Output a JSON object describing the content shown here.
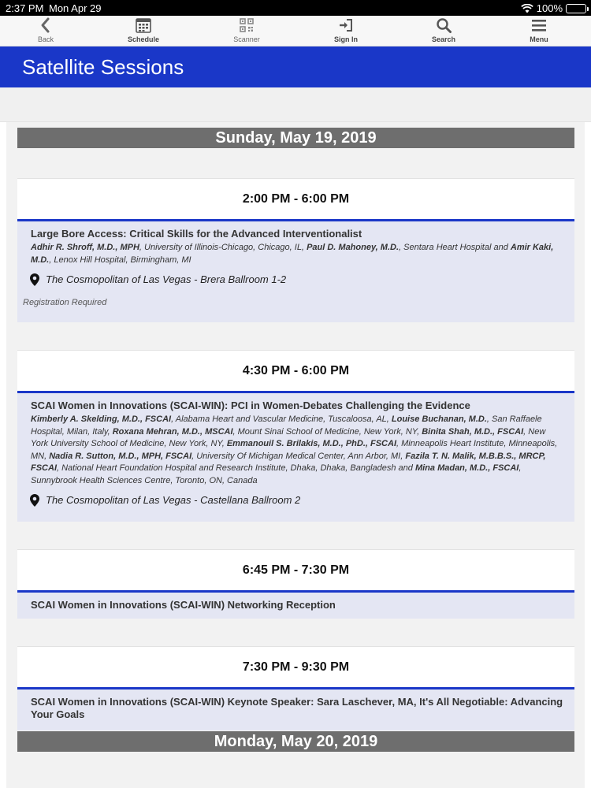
{
  "status_bar": {
    "time": "2:37 PM",
    "date": "Mon Apr 29",
    "battery": "100%"
  },
  "toolbar": {
    "back": "Back",
    "schedule": "Schedule",
    "scanner": "Scanner",
    "sign_in": "Sign In",
    "search": "Search",
    "menu": "Menu"
  },
  "header": {
    "title": "Satellite Sessions"
  },
  "days": [
    {
      "date": "Sunday, May 19, 2019",
      "slots": [
        {
          "time": "2:00 PM - 6:00 PM",
          "title": "Large Bore Access: Critical Skills for the Advanced Interventionalist",
          "speakers": [
            {
              "name": "Adhir R. Shroff, M.D., MPH",
              "affiliation": ", University of Illinois-Chicago, Chicago, IL, "
            },
            {
              "name": "Paul D. Mahoney, M.D.",
              "affiliation": ", Sentara Heart Hospital and "
            },
            {
              "name": "Amir Kaki, M.D.",
              "affiliation": ", Lenox Hill Hospital, Birmingham, MI"
            }
          ],
          "location": "The Cosmopolitan of Las Vegas - Brera Ballroom 1-2",
          "note": "Registration Required"
        },
        {
          "time": "4:30 PM - 6:00 PM",
          "title": "SCAI Women in Innovations (SCAI-WIN): PCI in Women-Debates Challenging the Evidence",
          "speakers": [
            {
              "name": "Kimberly A. Skelding, M.D., FSCAI",
              "affiliation": ", Alabama Heart and Vascular Medicine, Tuscaloosa, AL, "
            },
            {
              "name": "Louise Buchanan, M.D.",
              "affiliation": ", San Raffaele Hospital, Milan, Italy, "
            },
            {
              "name": "Roxana Mehran, M.D., MSCAI",
              "affiliation": ", Mount Sinai School of Medicine, New York, NY, "
            },
            {
              "name": "Binita Shah, M.D., FSCAI",
              "affiliation": ", New York University School of Medicine, New York, NY, "
            },
            {
              "name": "Emmanouil S. Brilakis, M.D., PhD., FSCAI",
              "affiliation": ", Minneapolis Heart Institute, Minneapolis, MN, "
            },
            {
              "name": "Nadia R. Sutton, M.D., MPH, FSCAI",
              "affiliation": ", University Of Michigan Medical Center, Ann Arbor, MI, "
            },
            {
              "name": "Fazila T. N. Malik, M.B.B.S., MRCP, FSCAI",
              "affiliation": ", National Heart Foundation Hospital and Research Institute, Dhaka, Dhaka, Bangladesh and "
            },
            {
              "name": "Mina Madan, M.D., FSCAI",
              "affiliation": ", Sunnybrook Health Sciences Centre, Toronto, ON, Canada"
            }
          ],
          "location": "The Cosmopolitan of Las Vegas - Castellana Ballroom 2"
        },
        {
          "time": "6:45 PM - 7:30 PM",
          "title": "SCAI Women in Innovations (SCAI-WIN) Networking Reception"
        },
        {
          "time": "7:30 PM - 9:30 PM",
          "title": "SCAI Women in Innovations (SCAI-WIN) Keynote Speaker: Sara Laschever, MA, It's All Negotiable: Advancing Your Goals"
        }
      ]
    },
    {
      "date": "Monday, May 20, 2019"
    }
  ],
  "colors": {
    "header_blue": "#1a37c8",
    "day_header_gray": "#6e6e6e",
    "session_bg": "#e4e6f3"
  }
}
